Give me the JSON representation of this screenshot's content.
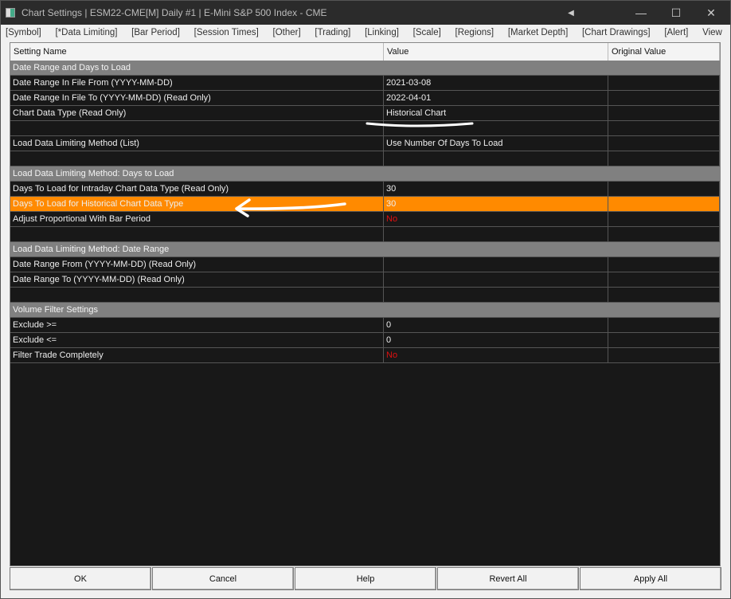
{
  "window": {
    "title": "Chart Settings | ESM22-CME[M]  Daily  #1 | E-Mini S&P 500 Index - CME"
  },
  "menu": [
    "[Symbol]",
    "[*Data Limiting]",
    "[Bar Period]",
    "[Session Times]",
    "[Other]",
    "[Trading]",
    "[Linking]",
    "[Scale]",
    "[Regions]",
    "[Market Depth]",
    "[Chart Drawings]",
    "[Alert]",
    "View"
  ],
  "columns": [
    "Setting Name",
    "Value",
    "Original Value"
  ],
  "rows": [
    {
      "type": "group",
      "name": "Date Range and Days to Load"
    },
    {
      "name": "Date Range In File From (YYYY-MM-DD)",
      "value": "2021-03-08"
    },
    {
      "name": "Date Range In File To (YYYY-MM-DD) (Read Only)",
      "value": "2022-04-01"
    },
    {
      "name": "Chart Data Type (Read Only)",
      "value": "Historical Chart"
    },
    {
      "type": "empty"
    },
    {
      "name": "Load Data Limiting Method (List)",
      "value": "Use Number Of Days To Load"
    },
    {
      "type": "empty"
    },
    {
      "type": "group",
      "name": "Load Data Limiting Method: Days to Load"
    },
    {
      "name": "Days To Load for Intraday Chart Data Type (Read Only)",
      "value": "30"
    },
    {
      "name": "Days To Load for Historical Chart Data Type",
      "value": "30",
      "selected": true
    },
    {
      "name": "Adjust Proportional With Bar Period",
      "value": "No",
      "red": true
    },
    {
      "type": "empty"
    },
    {
      "type": "group",
      "name": "Load Data Limiting Method: Date Range"
    },
    {
      "name": "Date Range From (YYYY-MM-DD) (Read Only)",
      "value": ""
    },
    {
      "name": "Date Range To (YYYY-MM-DD) (Read Only)",
      "value": ""
    },
    {
      "type": "empty"
    },
    {
      "type": "group",
      "name": "Volume Filter Settings"
    },
    {
      "name": "Exclude >=",
      "value": "0"
    },
    {
      "name": "Exclude <=",
      "value": "0"
    },
    {
      "name": "Filter Trade Completely",
      "value": "No",
      "red": true
    }
  ],
  "buttons": [
    "OK",
    "Cancel",
    "Help",
    "Revert All",
    "Apply All"
  ],
  "colors": {
    "selected": "#ff8a00",
    "group": "#808080",
    "grid": "#181818",
    "no": "#e01010"
  }
}
